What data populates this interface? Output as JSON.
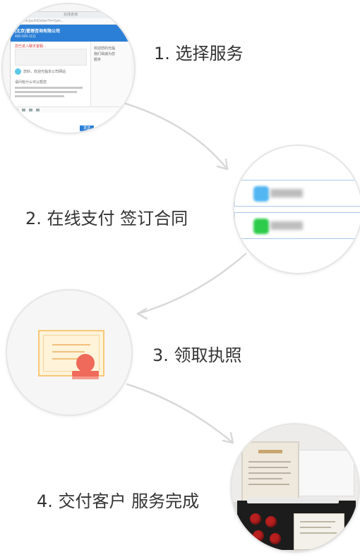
{
  "steps": [
    {
      "label": "1. 选择服务"
    },
    {
      "label": "2. 在线支付 签订合同"
    },
    {
      "label": "3. 领取执照"
    },
    {
      "label": "4. 交付客户 服务完成"
    }
  ],
  "step1_window": {
    "title": "在线咨询",
    "url": "cs.com/c/pc/hiOnline?h=Vpm...",
    "company": "(北京)管理咨询有限公司",
    "subtitle": "400-000-1111",
    "chat_lines": [
      "您已进入聊天客服...",
      "您好，欢迎光临本公司网站",
      "请问有什么可以帮您"
    ],
    "side_text": [
      "欢迎您的光临",
      "我们竭诚为您",
      "服务"
    ],
    "send_label": "发送"
  },
  "colors": {
    "accent_blue": "#2b7fd6",
    "arrow_gray": "#d8d8d8",
    "alipay_blue": "#52b6f2",
    "wechat_green": "#2ccc4a",
    "seal_red": "#ef6a5a",
    "cert_orange": "#f8c878"
  }
}
